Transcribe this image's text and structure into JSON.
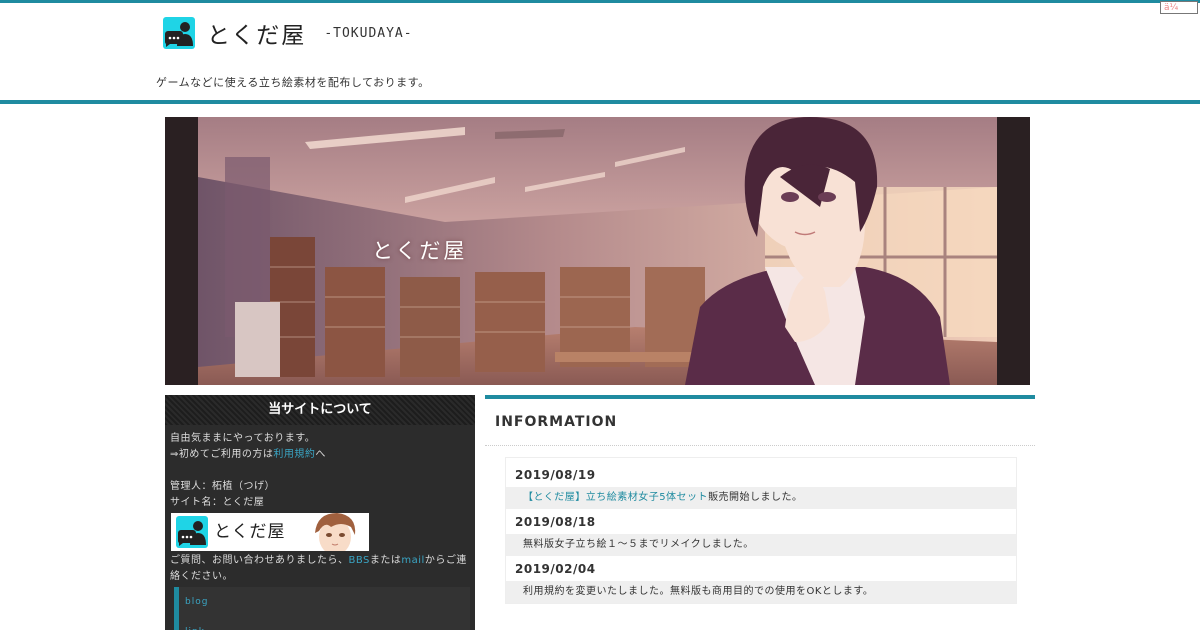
{
  "header": {
    "title": "とくだ屋",
    "subtitle": "-TOKUDAYA-",
    "tagline": "ゲームなどに使える立ち絵素材を配布しております。",
    "corner_badge": "ä¼"
  },
  "hero": {
    "overlay_title": "とくだ屋"
  },
  "sidebar": {
    "heading": "当サイトについて",
    "intro": "自由気ままにやっております。",
    "first_time_prefix": "⇒初めてご利用の方は",
    "terms_link": "利用規約",
    "first_time_suffix": "へ",
    "admin": "管理人：柘植（つげ）",
    "site_name": "サイト名：とくだ屋",
    "banner_text": "とくだ屋",
    "contact_prefix": "ご質問、お問い合わせありましたら、",
    "bbs_link": "BBS",
    "contact_or": "または",
    "mail_link": "mail",
    "contact_suffix": "からご連絡ください。",
    "links": [
      "blog",
      "link"
    ]
  },
  "info": {
    "heading": "INFORMATION",
    "news": [
      {
        "date": "2019/08/19",
        "link": "【とくだ屋】立ち絵素材女子5体セット",
        "text": "販売開始しました。"
      },
      {
        "date": "2019/08/18",
        "link": "",
        "text": "無料版女子立ち絵１～５までリメイクしました。"
      },
      {
        "date": "2019/02/04",
        "link": "",
        "text": "利用規約を変更いたしました。無料版も商用目的での使用をOKとします。"
      }
    ]
  },
  "colors": {
    "accent": "#1f8ba0",
    "link": "#3aa5c4",
    "sidebar_bg": "#2c2c2c"
  }
}
